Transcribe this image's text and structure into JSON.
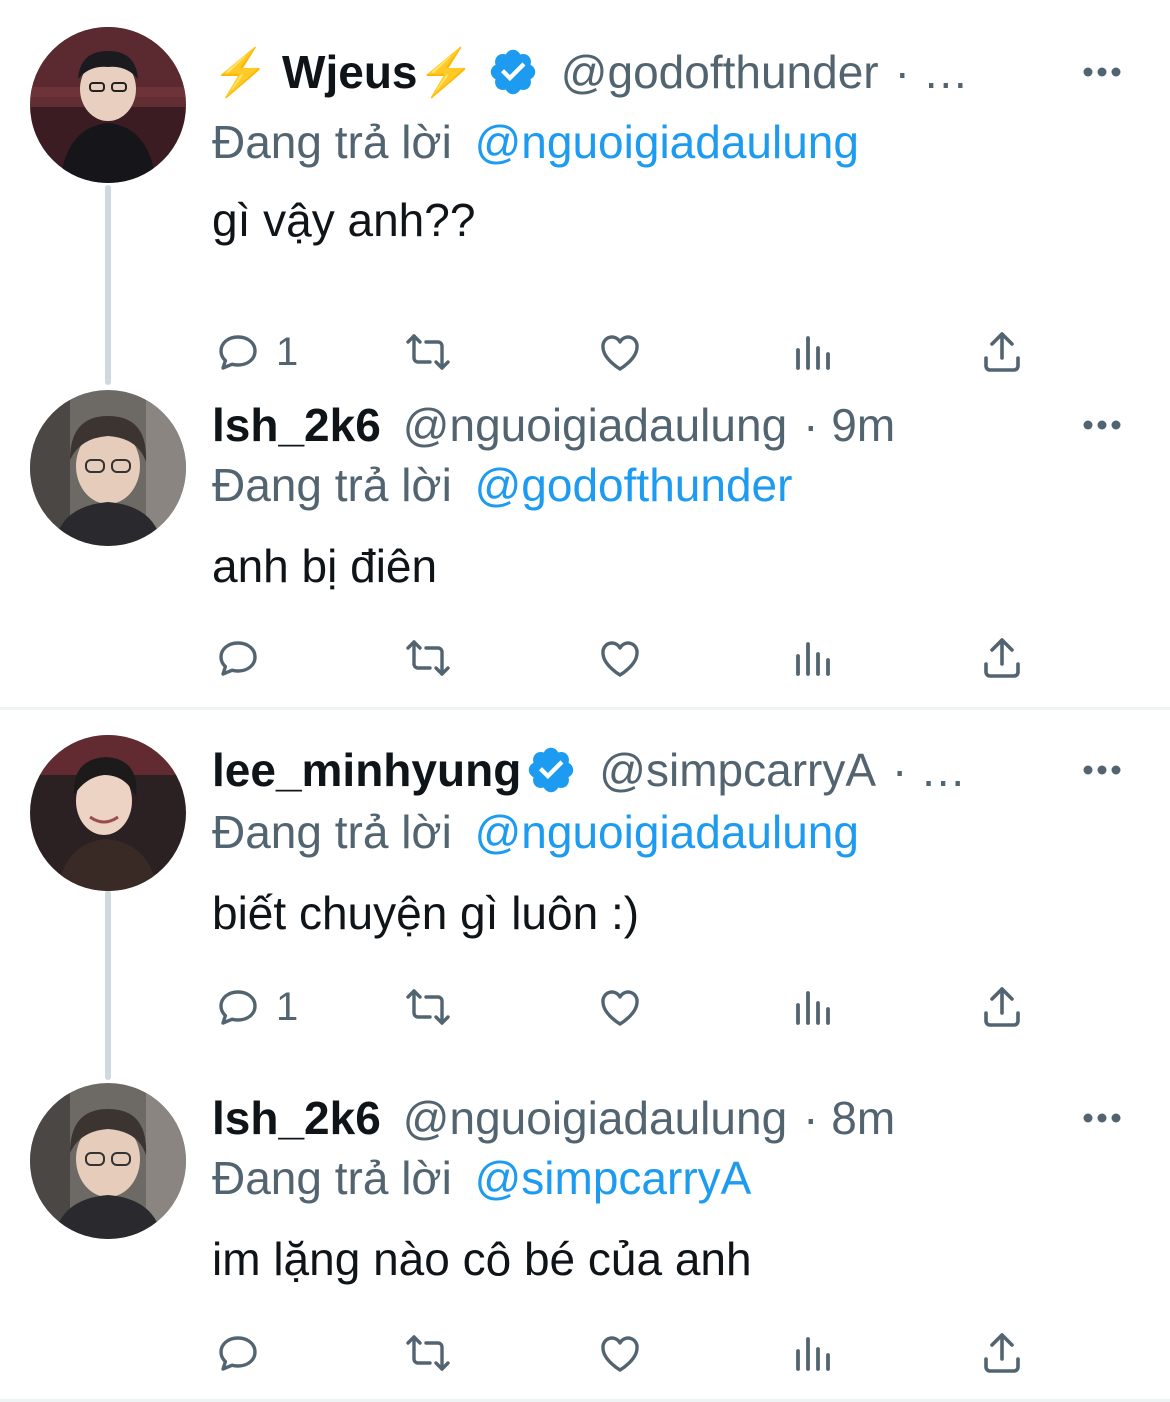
{
  "colors": {
    "accent": "#1d9bf0",
    "secondary": "#536471",
    "text": "#0f1419",
    "line": "#cfd9de"
  },
  "tweets": [
    {
      "name": "⚡️ Wjeus⚡️",
      "verified": true,
      "handle": "@godofthunder",
      "meta": "· …",
      "replying_prefix": "Đang trả lời",
      "replying_to": "@nguoigiadaulung",
      "text": "gì vậy anh??",
      "reply_count": "1",
      "icons": [
        "reply-icon",
        "retweet-icon",
        "like-icon",
        "views-icon",
        "share-icon"
      ]
    },
    {
      "name": "lsh_2k6",
      "verified": false,
      "handle": "@nguoigiadaulung",
      "meta": "· 9m",
      "replying_prefix": "Đang trả lời",
      "replying_to": "@godofthunder",
      "text": "anh bị điên",
      "reply_count": ""
    },
    {
      "name": "lee_minhyung",
      "verified": true,
      "handle": "@simpcarryA",
      "meta": "· …",
      "replying_prefix": "Đang trả lời",
      "replying_to": "@nguoigiadaulung",
      "text": "biết chuyện gì luôn :)",
      "reply_count": "1"
    },
    {
      "name": "lsh_2k6",
      "verified": false,
      "handle": "@nguoigiadaulung",
      "meta": "· 8m",
      "replying_prefix": "Đang trả lời",
      "replying_to": "@simpcarryA",
      "text": "im lặng nào cô bé của anh",
      "reply_count": ""
    }
  ]
}
